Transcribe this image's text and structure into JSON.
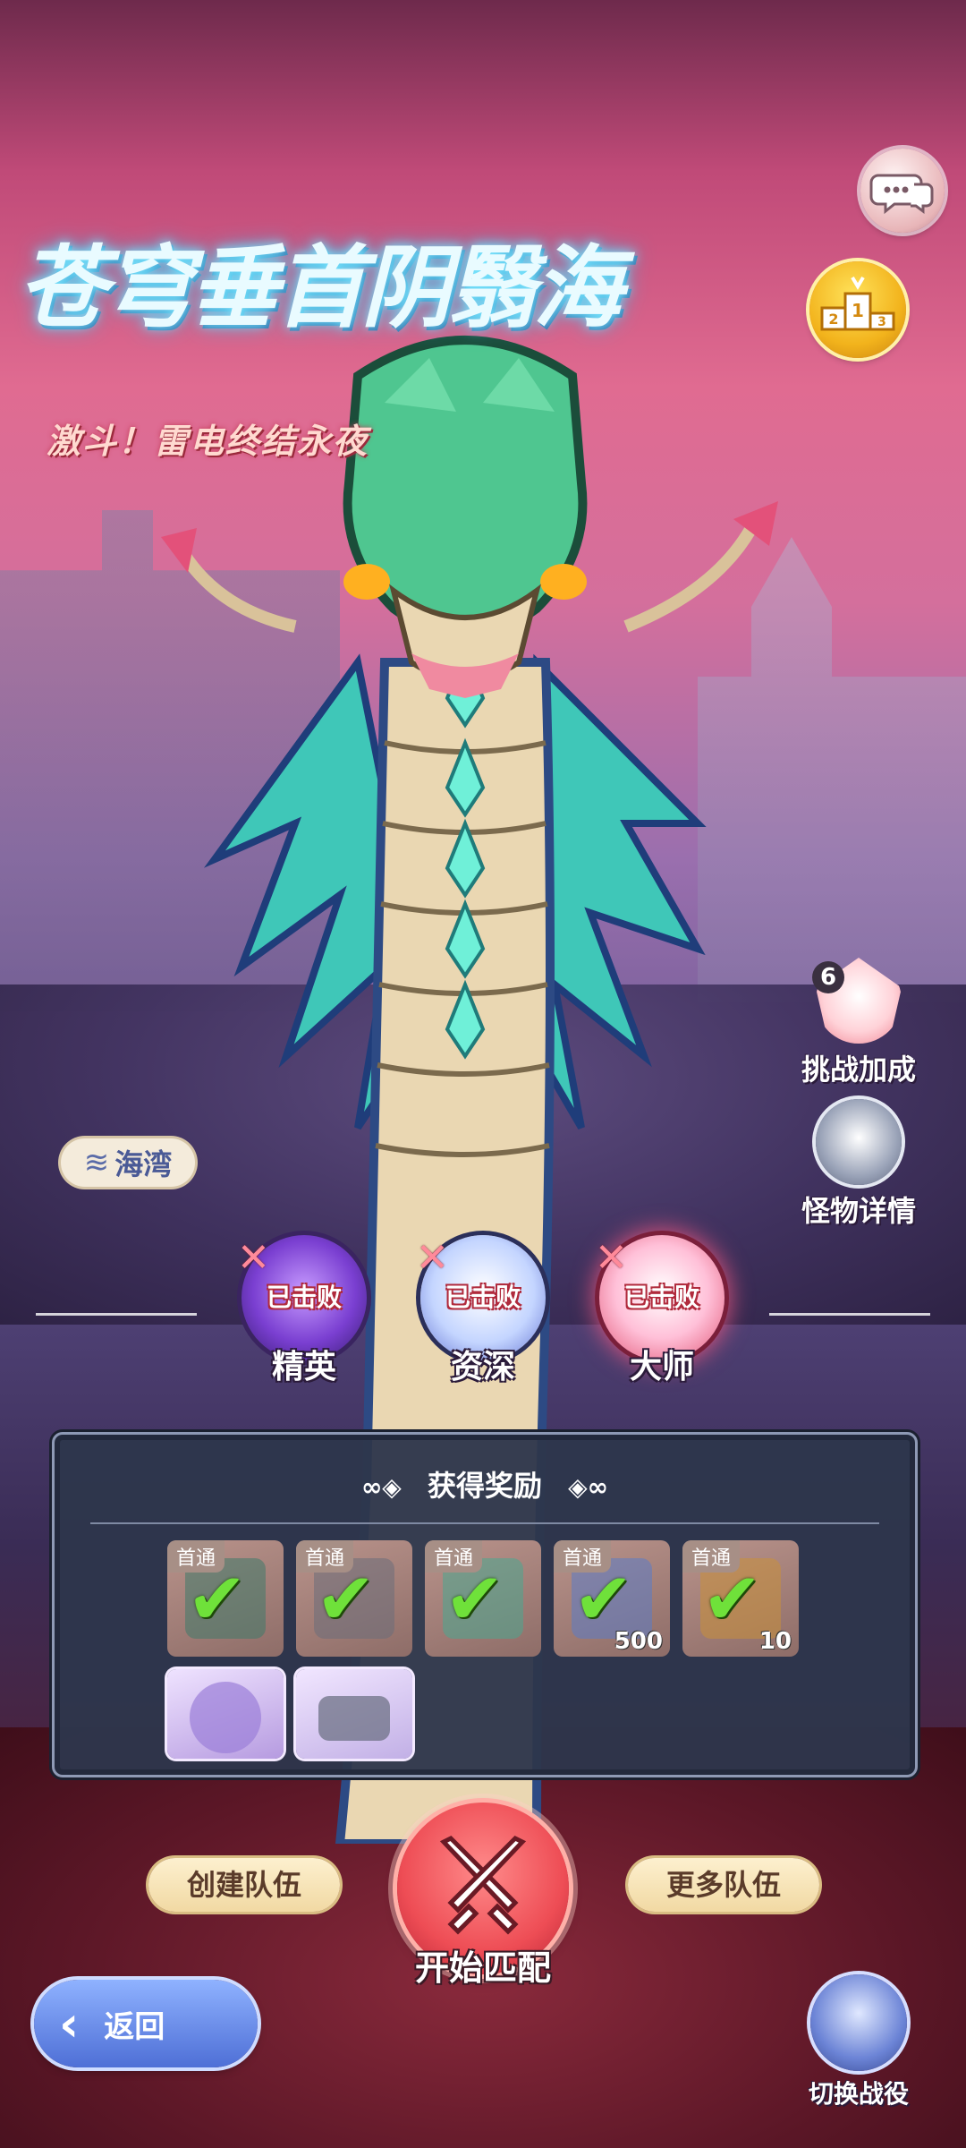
{
  "event": {
    "title": "苍穹垂首阴翳海",
    "subtitle": "激斗！雷电终结永夜"
  },
  "location": {
    "label": "海湾",
    "icon": "wave-icon"
  },
  "top_buttons": {
    "chat_icon": "chat-bubble-icon",
    "ranking_icon": "podium-icon"
  },
  "side_buttons": {
    "challenge_bonus_label": "挑战加成",
    "challenge_bonus_count": "6",
    "monster_info_label": "怪物详情"
  },
  "difficulties": [
    {
      "label": "精英",
      "status": "已击败"
    },
    {
      "label": "资深",
      "status": "已击败"
    },
    {
      "label": "大师",
      "status": "已击败"
    }
  ],
  "rewards": {
    "title": "获得奖励",
    "items": [
      {
        "tag": "首通",
        "claimed": true,
        "qty": ""
      },
      {
        "tag": "首通",
        "claimed": true,
        "qty": ""
      },
      {
        "tag": "首通",
        "claimed": true,
        "qty": ""
      },
      {
        "tag": "首通",
        "claimed": true,
        "qty": "500"
      },
      {
        "tag": "首通",
        "claimed": true,
        "qty": "10"
      },
      {
        "tag": "",
        "claimed": false,
        "qty": ""
      },
      {
        "tag": "",
        "claimed": false,
        "qty": ""
      }
    ]
  },
  "actions": {
    "create_team": "创建队伍",
    "start_match": "开始匹配",
    "more_teams": "更多队伍",
    "back": "返回",
    "switch_campaign": "切换战役"
  },
  "colors": {
    "accent_red": "#ee4d55",
    "check_green": "#6fe13a",
    "panel_bg": "#2e364c",
    "back_blue": "#4e6fd6"
  }
}
